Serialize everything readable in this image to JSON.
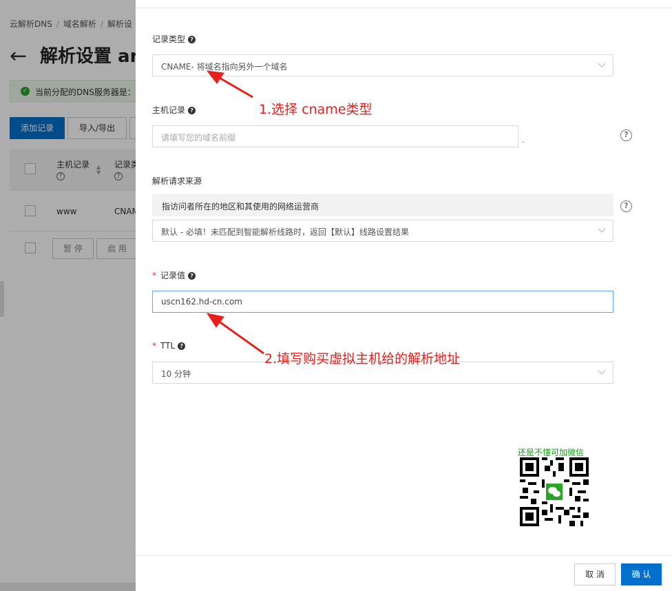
{
  "background": {
    "breadcrumb": [
      "云解析DNS",
      "域名解析",
      "解析设"
    ],
    "page_title": "解析设置 ar",
    "dns_notice": "当前分配的DNS服务器是：d",
    "add_record_button": "添加记录",
    "import_export_button": "导入/导出",
    "table_headers": [
      "主机记录",
      "记录类"
    ],
    "row": {
      "host": "www",
      "type": "CNAM"
    },
    "pause_button": "暂 停",
    "enable_button": "启 用"
  },
  "form": {
    "record_type": {
      "label": "记录类型",
      "value": "CNAME- 将域名指向另外一个域名"
    },
    "host_record": {
      "label": "主机记录",
      "placeholder": "请填写您的域名前缀",
      "suffix": "."
    },
    "request_source": {
      "label": "解析请求来源",
      "hint": "指访问者所在的地区和其使用的网络运营商",
      "value": "默认 - 必填！未匹配到智能解析线路时，返回【默认】线路设置结果"
    },
    "record_value": {
      "label": "记录值",
      "value": "uscn162.hd-cn.com"
    },
    "ttl": {
      "label": "TTL",
      "value": "10 分钟"
    },
    "required_mark": "*"
  },
  "annotations": {
    "step1": "1.选择 cname类型",
    "step2": "2.填写购买虚拟主机给的解析地址",
    "qr_caption": "还是不懂可加微信",
    "color": "#e8201c"
  },
  "footer": {
    "cancel": "取 消",
    "confirm": "确 认"
  },
  "colors": {
    "primary": "#0070cc",
    "focus_border": "#5aa8e6",
    "success": "#2ea02e",
    "wechat_green": "#1d9a1d"
  }
}
